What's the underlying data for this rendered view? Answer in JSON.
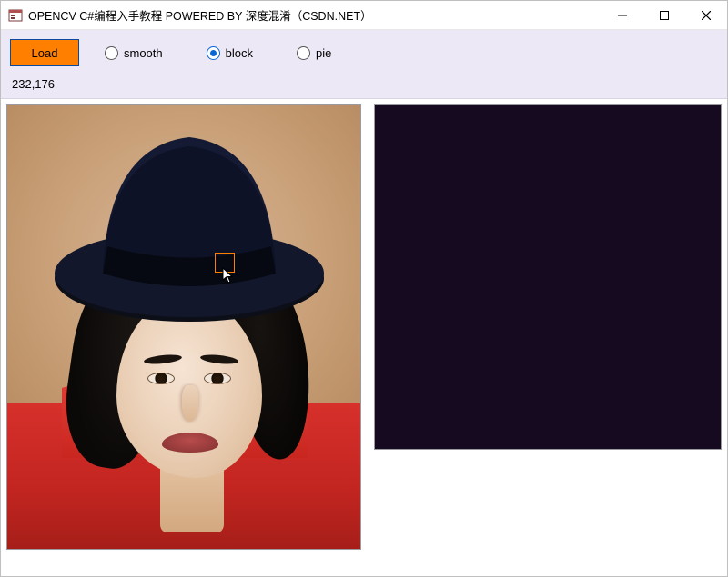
{
  "window": {
    "title": "OPENCV C#编程入手教程 POWERED BY 深度混淆（CSDN.NET）"
  },
  "toolbar": {
    "load_label": "Load",
    "radios": {
      "smooth": "smooth",
      "block": "block",
      "pie": "pie",
      "selected": "block"
    }
  },
  "status": {
    "coordinates": "232,176"
  },
  "icons": {
    "app": "form-icon",
    "minimize": "minimize-icon",
    "maximize": "maximize-icon",
    "close": "close-icon",
    "cursor": "arrow-cursor-icon"
  }
}
